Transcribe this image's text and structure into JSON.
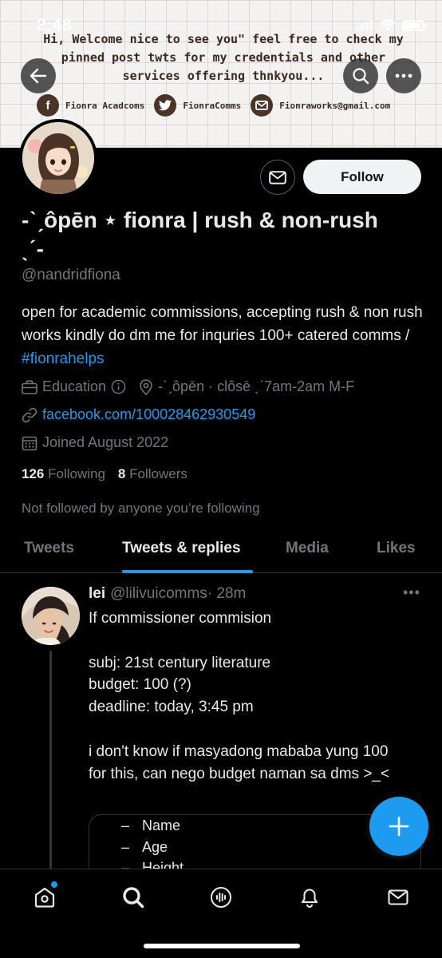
{
  "status_bar": {
    "time": "2:48"
  },
  "banner": {
    "message": "Hi, Welcome nice to see you\" feel free to check my pinned post twts for my credentials and other services offering thnkyou...",
    "contacts": [
      {
        "icon": "facebook-icon",
        "glyph": "f",
        "label": "Fionra Acadcoms"
      },
      {
        "icon": "twitter-icon",
        "glyph": "",
        "label": "FionraComms"
      },
      {
        "icon": "mail-icon",
        "glyph": "",
        "label": "Fionraworks@gmail.com"
      }
    ]
  },
  "profile": {
    "display_name": "-ˋˏôpēn ⋆ fionra | rush & non-rush ˎˊ-",
    "handle": "@nandridfiona",
    "bio_text": "open for academic commissions, accepting rush & non rush works kindly do dm me for inquries 100+ catered comms / ",
    "bio_hashtag": "#fionrahelps",
    "category": "Education",
    "location": "-ˋˏôpēn · clôsē ˎˊ7am-2am M-F",
    "website": "facebook.com/100028462930549",
    "joined": "Joined August 2022",
    "following_count": "126",
    "following_label": "Following",
    "followers_count": "8",
    "followers_label": "Followers",
    "not_followed_text": "Not followed by anyone you’re following",
    "follow_label": "Follow"
  },
  "tabs": [
    {
      "label": "Tweets",
      "active": false
    },
    {
      "label": "Tweets & replies",
      "active": true
    },
    {
      "label": "Media",
      "active": false
    },
    {
      "label": "Likes",
      "active": false
    }
  ],
  "tweet": {
    "author": "lei",
    "handle": "@lilivuicomms",
    "time": "· 28m",
    "body": "If commissioner commision\n\nsubj: 21st century literature\nbudget: 100 (?)\ndeadline: today, 3:45 pm\n\ni don't know if masyadong mababa yung 100 for this, can nego budget naman sa dms >_<",
    "quote_items": [
      "Name",
      "Age",
      "Height"
    ]
  },
  "colors": {
    "accent": "#1d9bf0",
    "background": "#000000",
    "text_primary": "#e7e9ea",
    "text_secondary": "#71767b"
  }
}
